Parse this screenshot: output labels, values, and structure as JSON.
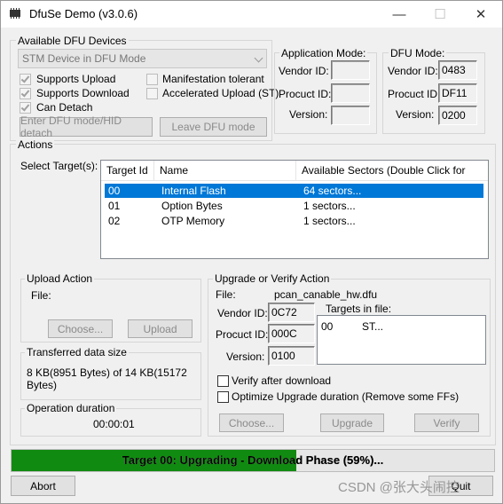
{
  "window": {
    "title": "DfuSe Demo (v3.0.6)",
    "minimize": "—",
    "maximize": "☐",
    "close": "✕"
  },
  "devices": {
    "group_title": "Available DFU Devices",
    "selected_device": "STM Device in DFU Mode",
    "supports_upload": "Supports Upload",
    "supports_download": "Supports Download",
    "can_detach": "Can Detach",
    "manifestation_tolerant": "Manifestation tolerant",
    "accelerated_upload": "Accelerated Upload (ST)",
    "enter_dfu_button": "Enter DFU mode/HID detach",
    "leave_dfu_button": "Leave DFU mode"
  },
  "app_mode": {
    "title": "Application Mode:",
    "vendor_label": "Vendor ID:",
    "product_label": "Procuct ID:",
    "version_label": "Version:",
    "vendor": "",
    "product": "",
    "version": ""
  },
  "dfu_mode": {
    "title": "DFU Mode:",
    "vendor_label": "Vendor ID:",
    "product_label": "Procuct ID:",
    "version_label": "Version:",
    "vendor": "0483",
    "product": "DF11",
    "version": "0200"
  },
  "actions": {
    "group_title": "Actions",
    "select_target_label": "Select Target(s):",
    "columns": [
      "Target Id",
      "Name",
      "Available Sectors (Double Click for more)"
    ],
    "rows": [
      {
        "id": "00",
        "name": "Internal Flash",
        "sectors": "64 sectors..."
      },
      {
        "id": "01",
        "name": "Option Bytes",
        "sectors": "1 sectors..."
      },
      {
        "id": "02",
        "name": "OTP Memory",
        "sectors": "1 sectors..."
      }
    ]
  },
  "upload": {
    "title": "Upload Action",
    "file_label": "File:",
    "choose_button": "Choose...",
    "upload_button": "Upload"
  },
  "transferred": {
    "title": "Transferred data size",
    "text": "8 KB(8951 Bytes) of 14 KB(15172 Bytes)"
  },
  "duration": {
    "title": "Operation duration",
    "value": "00:00:01"
  },
  "upgrade": {
    "title": "Upgrade or Verify Action",
    "file_label": "File:",
    "file_value": "pcan_canable_hw.dfu",
    "vendor_label": "Vendor ID:",
    "product_label": "Procuct ID:",
    "version_label": "Version:",
    "vendor": "0C72",
    "product": "000C",
    "version": "0100",
    "targets_label": "Targets in file:",
    "target_id": "00",
    "target_name": "ST...",
    "verify_after": "Verify after download",
    "optimize": "Optimize Upgrade duration (Remove some FFs)",
    "choose_button": "Choose...",
    "upgrade_button": "Upgrade",
    "verify_button": "Verify"
  },
  "progress": {
    "percent": 59,
    "text": "Target 00: Upgrading - Download Phase (59%)..."
  },
  "footer": {
    "abort_button": "Abort",
    "quit_button": "Quit",
    "watermark": "CSDN @张大头闹控"
  },
  "colors": {
    "selection": "#0078d7",
    "progress_fill": "#118a11"
  }
}
